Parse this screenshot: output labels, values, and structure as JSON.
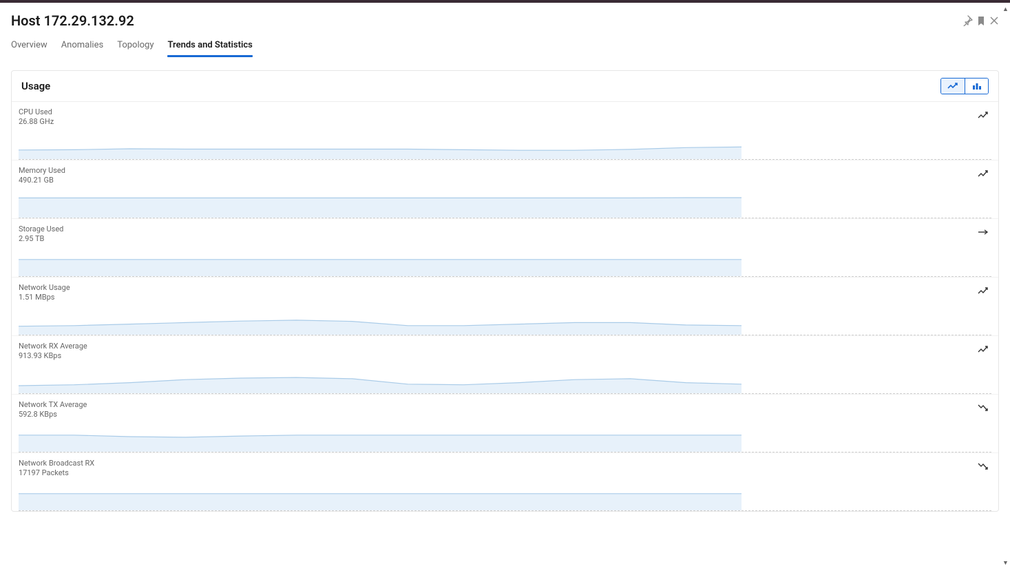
{
  "header": {
    "title": "Host 172.29.132.92"
  },
  "tabs": [
    {
      "label": "Overview",
      "active": false
    },
    {
      "label": "Anomalies",
      "active": false
    },
    {
      "label": "Topology",
      "active": false
    },
    {
      "label": "Trends and Statistics",
      "active": true
    }
  ],
  "panel": {
    "title": "Usage"
  },
  "metrics": [
    {
      "label": "CPU Used",
      "value": "26.88 GHz",
      "trend": "up",
      "spark": [
        0.3,
        0.31,
        0.34,
        0.33,
        0.33,
        0.33,
        0.33,
        0.33,
        0.31,
        0.29,
        0.29,
        0.32,
        0.38,
        0.4
      ]
    },
    {
      "label": "Memory Used",
      "value": "490.21 GB",
      "trend": "up",
      "spark": [
        0.65,
        0.65,
        0.65,
        0.65,
        0.65,
        0.65,
        0.65,
        0.65,
        0.65,
        0.65,
        0.65,
        0.65,
        0.66,
        0.66
      ]
    },
    {
      "label": "Storage Used",
      "value": "2.95 TB",
      "trend": "flat",
      "spark": [
        0.55,
        0.55,
        0.55,
        0.55,
        0.55,
        0.55,
        0.55,
        0.55,
        0.55,
        0.55,
        0.55,
        0.55,
        0.55,
        0.55
      ]
    },
    {
      "label": "Network Usage",
      "value": "1.51 MBps",
      "trend": "up",
      "spark": [
        0.28,
        0.3,
        0.35,
        0.4,
        0.45,
        0.48,
        0.44,
        0.3,
        0.3,
        0.35,
        0.4,
        0.4,
        0.32,
        0.3
      ]
    },
    {
      "label": "Network RX Average",
      "value": "913.93 KBps",
      "trend": "up",
      "spark": [
        0.25,
        0.28,
        0.35,
        0.45,
        0.5,
        0.52,
        0.48,
        0.3,
        0.28,
        0.35,
        0.45,
        0.48,
        0.35,
        0.3
      ]
    },
    {
      "label": "Network TX Average",
      "value": "592.8 KBps",
      "trend": "down",
      "spark": [
        0.55,
        0.55,
        0.5,
        0.48,
        0.52,
        0.55,
        0.55,
        0.55,
        0.55,
        0.55,
        0.55,
        0.55,
        0.55,
        0.55
      ]
    },
    {
      "label": "Network Broadcast RX",
      "value": "17197 Packets",
      "trend": "down",
      "spark": [
        0.55,
        0.55,
        0.55,
        0.55,
        0.55,
        0.55,
        0.55,
        0.55,
        0.55,
        0.55,
        0.55,
        0.55,
        0.55,
        0.55
      ]
    }
  ],
  "chart_data": [
    {
      "type": "area",
      "title": "CPU Used",
      "ylabel": "GHz",
      "value": 26.88,
      "series": [
        {
          "name": "cpu",
          "values": [
            0.3,
            0.31,
            0.34,
            0.33,
            0.33,
            0.33,
            0.33,
            0.33,
            0.31,
            0.29,
            0.29,
            0.32,
            0.38,
            0.4
          ]
        }
      ]
    },
    {
      "type": "area",
      "title": "Memory Used",
      "ylabel": "GB",
      "value": 490.21,
      "series": [
        {
          "name": "memory",
          "values": [
            0.65,
            0.65,
            0.65,
            0.65,
            0.65,
            0.65,
            0.65,
            0.65,
            0.65,
            0.65,
            0.65,
            0.65,
            0.66,
            0.66
          ]
        }
      ]
    },
    {
      "type": "area",
      "title": "Storage Used",
      "ylabel": "TB",
      "value": 2.95,
      "series": [
        {
          "name": "storage",
          "values": [
            0.55,
            0.55,
            0.55,
            0.55,
            0.55,
            0.55,
            0.55,
            0.55,
            0.55,
            0.55,
            0.55,
            0.55,
            0.55,
            0.55
          ]
        }
      ]
    },
    {
      "type": "area",
      "title": "Network Usage",
      "ylabel": "MBps",
      "value": 1.51,
      "series": [
        {
          "name": "net",
          "values": [
            0.28,
            0.3,
            0.35,
            0.4,
            0.45,
            0.48,
            0.44,
            0.3,
            0.3,
            0.35,
            0.4,
            0.4,
            0.32,
            0.3
          ]
        }
      ]
    },
    {
      "type": "area",
      "title": "Network RX Average",
      "ylabel": "KBps",
      "value": 913.93,
      "series": [
        {
          "name": "rx",
          "values": [
            0.25,
            0.28,
            0.35,
            0.45,
            0.5,
            0.52,
            0.48,
            0.3,
            0.28,
            0.35,
            0.45,
            0.48,
            0.35,
            0.3
          ]
        }
      ]
    },
    {
      "type": "area",
      "title": "Network TX Average",
      "ylabel": "KBps",
      "value": 592.8,
      "series": [
        {
          "name": "tx",
          "values": [
            0.55,
            0.55,
            0.5,
            0.48,
            0.52,
            0.55,
            0.55,
            0.55,
            0.55,
            0.55,
            0.55,
            0.55,
            0.55,
            0.55
          ]
        }
      ]
    },
    {
      "type": "area",
      "title": "Network Broadcast RX",
      "ylabel": "Packets",
      "value": 17197,
      "series": [
        {
          "name": "broadcast_rx",
          "values": [
            0.55,
            0.55,
            0.55,
            0.55,
            0.55,
            0.55,
            0.55,
            0.55,
            0.55,
            0.55,
            0.55,
            0.55,
            0.55,
            0.55
          ]
        }
      ]
    }
  ],
  "colors": {
    "accent": "#1769d4",
    "spark_stroke": "#a9cbe8",
    "spark_fill": "#e7f1fa"
  }
}
